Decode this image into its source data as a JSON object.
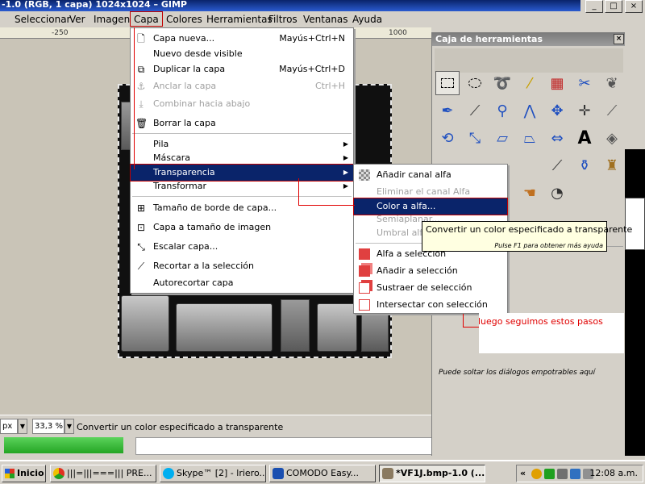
{
  "window": {
    "title": "-1.0 (RGB, 1 capa) 1024x1024 – GIMP",
    "controls": [
      "_",
      "□",
      "×"
    ]
  },
  "menubar": [
    "Seleccionar",
    "Ver",
    "Imagen",
    "Capa",
    "Colores",
    "Herramientas",
    "Filtros",
    "Ventanas",
    "Ayuda"
  ],
  "ruler": {
    "mark_left": "-250",
    "mark_right": "1000"
  },
  "capa_menu": {
    "items": [
      {
        "label": "Capa nueva...",
        "shortcut": "Mayús+Ctrl+N",
        "icon": "new-layer-icon"
      },
      {
        "label": "Nuevo desde visible",
        "shortcut": "",
        "icon": ""
      },
      {
        "label": "Duplicar la capa",
        "shortcut": "Mayús+Ctrl+D",
        "icon": "duplicate-layer-icon"
      },
      {
        "label": "Anclar la capa",
        "shortcut": "Ctrl+H",
        "icon": "anchor-icon",
        "disabled": true
      },
      {
        "label": "Combinar hacia abajo",
        "shortcut": "",
        "icon": "merge-down-icon",
        "disabled": true
      },
      {
        "label": "Borrar la capa",
        "shortcut": "",
        "icon": "delete-layer-icon"
      },
      {
        "label": "Pila",
        "submenu": true
      },
      {
        "label": "Máscara",
        "submenu": true
      },
      {
        "label": "Transparencia",
        "submenu": true,
        "highlighted": true
      },
      {
        "label": "Transformar",
        "submenu": true
      },
      {
        "label": "Tamaño de borde de capa...",
        "icon": "layer-boundary-icon"
      },
      {
        "label": "Capa a tamaño de imagen",
        "icon": "layer-to-image-icon"
      },
      {
        "label": "Escalar capa...",
        "icon": "scale-layer-icon"
      },
      {
        "label": "Recortar a la selección",
        "icon": "crop-icon"
      },
      {
        "label": "Autorecortar capa",
        "icon": ""
      }
    ]
  },
  "transparency_menu": {
    "items": [
      {
        "label": "Añadir canal alfa",
        "icon": "add-alpha-icon"
      },
      {
        "label": "Eliminar el canal Alfa",
        "disabled": true
      },
      {
        "label": "Color a alfa...",
        "highlighted": true
      },
      {
        "label": "Semiaplanar...",
        "disabled": true
      },
      {
        "label": "Umbral alfa...",
        "disabled": true
      },
      {
        "label": "Alfa a selección",
        "icon": "alpha-to-selection-icon"
      },
      {
        "label": "Añadir a selección",
        "icon": "add-to-selection-icon"
      },
      {
        "label": "Sustraer de selección",
        "icon": "subtract-selection-icon"
      },
      {
        "label": "Intersectar con selección",
        "icon": "intersect-selection-icon"
      }
    ]
  },
  "tooltip": {
    "text": "Convertir un color especificado a transparente",
    "hint": "Pulse F1 para obtener más ayuda"
  },
  "annotation": {
    "text": "luego seguimos estos pasos",
    "color": "#e00000"
  },
  "toolbox": {
    "title": "Caja de herramientas",
    "close": "×",
    "hint": "Puede soltar los diálogos empotrables aquí"
  },
  "statusbar": {
    "unit": "px",
    "zoom": "33,3 %",
    "message": "Convertir un color especificado a transparente"
  },
  "taskbar": {
    "start": "Inicio",
    "tasks": [
      "|||=|||===||| PRE...",
      "Skype™ [2] - lriero...",
      "COMODO Easy...",
      "*VF1J.bmp-1.0 (..."
    ],
    "tray_chevron": "«",
    "clock": "12:08 a.m."
  },
  "colors": {
    "highlight": "#0a246a",
    "title_bar": "#0a246a",
    "face": "#d4d0c8",
    "annotation": "#e00000"
  }
}
